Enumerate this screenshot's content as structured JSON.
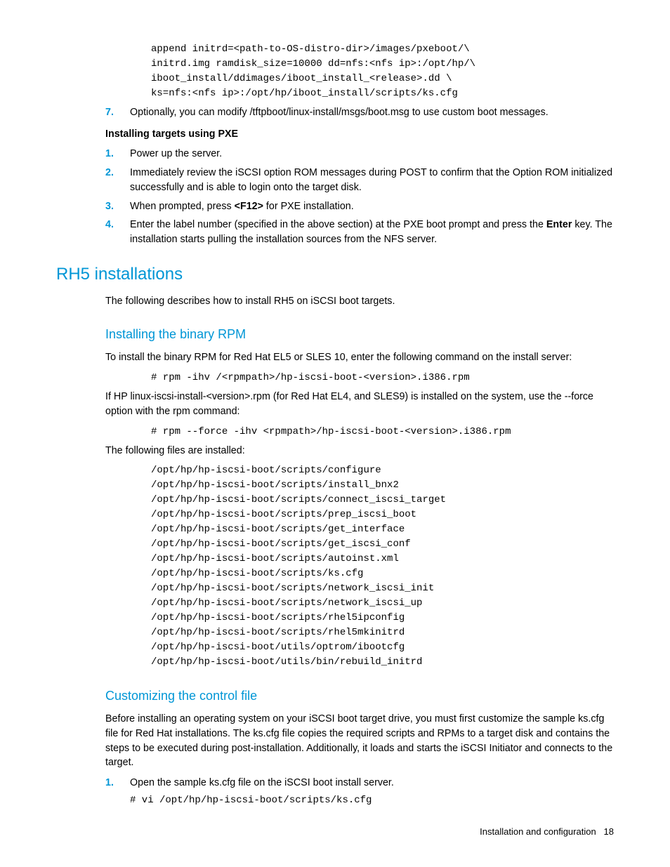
{
  "topCode": "append initrd=<path-to-OS-distro-dir>/images/pxeboot/\\\ninitrd.img ramdisk_size=10000 dd=nfs:<nfs ip>:/opt/hp/\\\niboot_install/ddimages/iboot_install_<release>.dd \\\nks=nfs:<nfs ip>:/opt/hp/iboot_install/scripts/ks.cfg",
  "step7": "Optionally, you can modify /tftpboot/linux-install/msgs/boot.msg to use custom boot messages.",
  "pxeHeading": "Installing targets using PXE",
  "pxe": {
    "s1": "Power up the server.",
    "s2": "Immediately review the iSCSI option ROM messages during POST to confirm that the Option ROM initialized successfully and is able to login onto the target disk.",
    "s3a": "When prompted, press ",
    "s3b": "<F12>",
    "s3c": " for PXE installation.",
    "s4a": "Enter the label number (specified in the above section) at the PXE boot prompt and press the ",
    "s4b": "Enter",
    "s4c": " key. The installation starts pulling the installation sources from the NFS server."
  },
  "rh5": {
    "title": "RH5 installations",
    "intro": "The following describes how to install RH5 on iSCSI boot targets."
  },
  "rpm": {
    "title": "Installing the binary RPM",
    "p1": "To install the binary RPM for Red Hat EL5 or SLES 10, enter the following command on the install server:",
    "cmd1": "# rpm -ihv /<rpmpath>/hp-iscsi-boot-<version>.i386.rpm",
    "p2": "If HP linux-iscsi-install-<version>.rpm (for Red Hat EL4, and SLES9) is installed on the system, use the --force option with the rpm command:",
    "cmd2": "# rpm --force -ihv <rpmpath>/hp-iscsi-boot-<version>.i386.rpm",
    "p3": "The following files are installed:",
    "files": "/opt/hp/hp-iscsi-boot/scripts/configure\n/opt/hp/hp-iscsi-boot/scripts/install_bnx2\n/opt/hp/hp-iscsi-boot/scripts/connect_iscsi_target\n/opt/hp/hp-iscsi-boot/scripts/prep_iscsi_boot\n/opt/hp/hp-iscsi-boot/scripts/get_interface\n/opt/hp/hp-iscsi-boot/scripts/get_iscsi_conf\n/opt/hp/hp-iscsi-boot/scripts/autoinst.xml\n/opt/hp/hp-iscsi-boot/scripts/ks.cfg\n/opt/hp/hp-iscsi-boot/scripts/network_iscsi_init\n/opt/hp/hp-iscsi-boot/scripts/network_iscsi_up\n/opt/hp/hp-iscsi-boot/scripts/rhel5ipconfig\n/opt/hp/hp-iscsi-boot/scripts/rhel5mkinitrd\n/opt/hp/hp-iscsi-boot/utils/optrom/ibootcfg\n/opt/hp/hp-iscsi-boot/utils/bin/rebuild_initrd"
  },
  "ctl": {
    "title": "Customizing the control file",
    "p1": "Before installing an operating system on your iSCSI boot target drive, you must first customize the sample ks.cfg file for Red Hat installations. The ks.cfg file copies the required scripts and RPMs to a target disk and contains the steps to be executed during post-installation. Additionally, it loads and starts the iSCSI Initiator and connects to the target.",
    "s1": "Open the sample ks.cfg file on the iSCSI boot install server.",
    "cmd": "# vi /opt/hp/hp-iscsi-boot/scripts/ks.cfg"
  },
  "footer": {
    "section": "Installation and configuration",
    "page": "18"
  }
}
